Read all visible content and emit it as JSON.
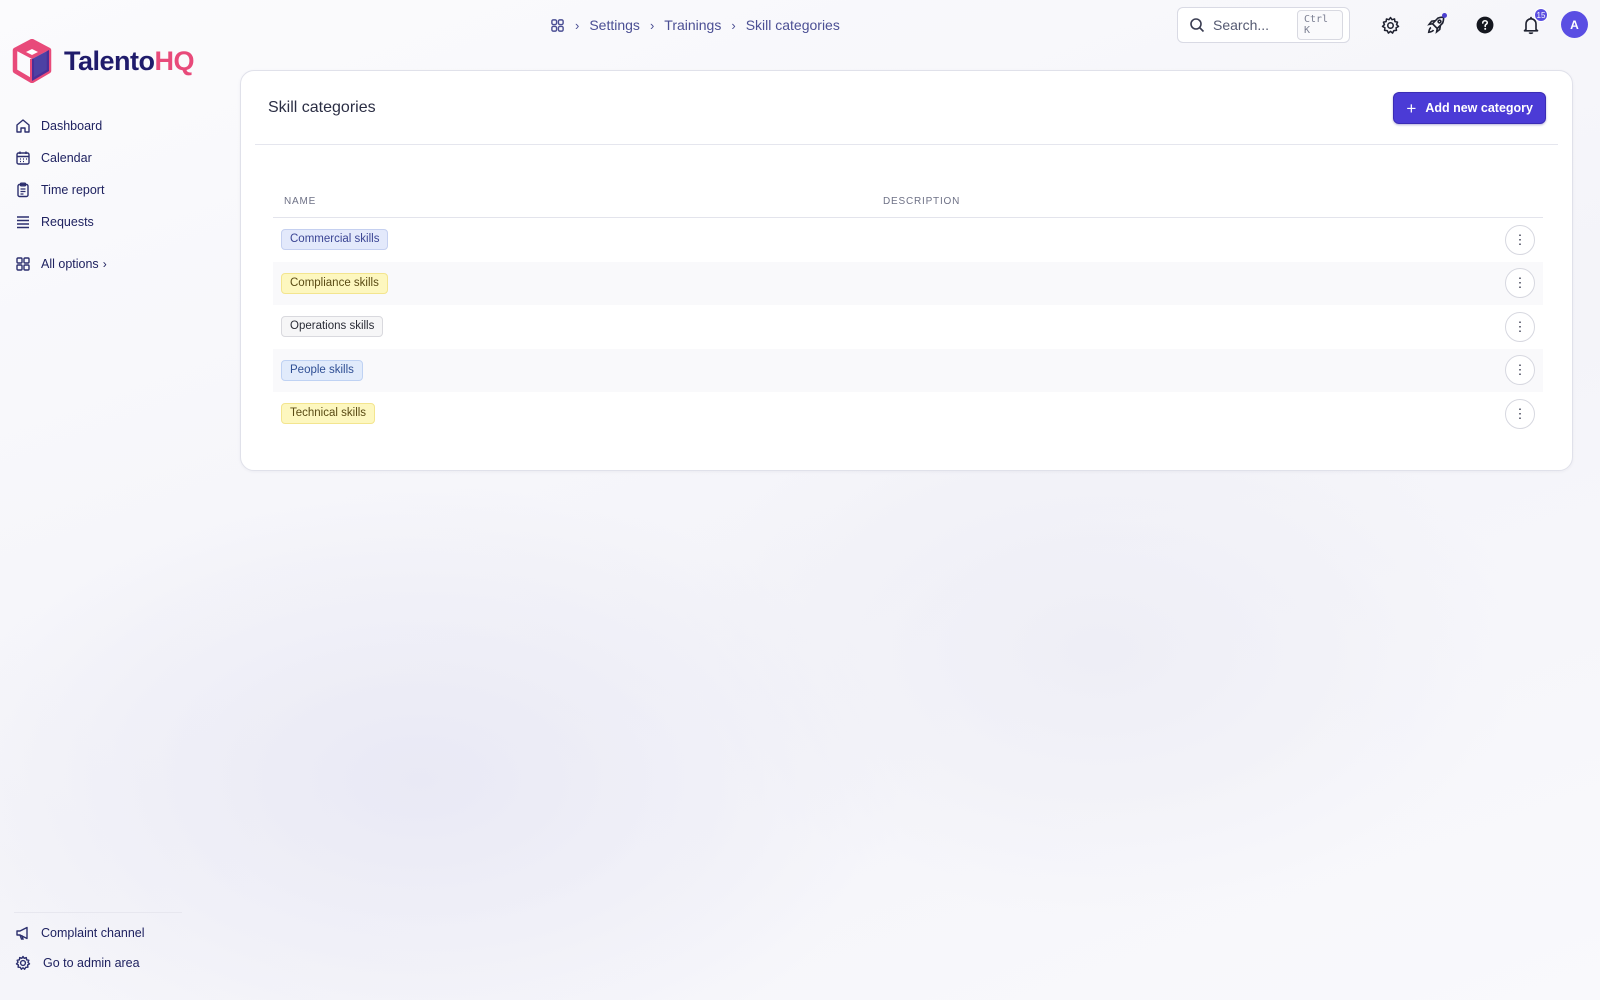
{
  "app": {
    "logo_part1": "Talento",
    "logo_part2": "HQ"
  },
  "sidebar": {
    "items": [
      {
        "label": "Dashboard",
        "icon": "home-icon"
      },
      {
        "label": "Calendar",
        "icon": "calendar-icon"
      },
      {
        "label": "Time report",
        "icon": "clipboard-icon"
      },
      {
        "label": "Requests",
        "icon": "list-icon"
      }
    ],
    "all_options": {
      "label": "All options",
      "icon": "grid-icon"
    },
    "bottom": [
      {
        "label": "Complaint channel",
        "icon": "megaphone-icon"
      },
      {
        "label": "Go to admin area",
        "icon": "gear-icon"
      }
    ]
  },
  "breadcrumb": {
    "home_icon": "grid-icon",
    "items": [
      "Settings",
      "Trainings",
      "Skill categories"
    ]
  },
  "search": {
    "placeholder": "Search...",
    "shortcut": "Ctrl K"
  },
  "topbar": {
    "notifications_count": "15",
    "avatar_initial": "A",
    "icons": [
      "gear-icon",
      "rocket-icon",
      "help-icon",
      "bell-icon"
    ]
  },
  "card": {
    "title": "Skill categories",
    "add_button_label": "Add new category"
  },
  "table": {
    "columns": [
      "NAME",
      "DESCRIPTION"
    ],
    "rows": [
      {
        "name": "Commercial skills",
        "description": "",
        "tag_color": "blue"
      },
      {
        "name": "Compliance skills",
        "description": "",
        "tag_color": "yellow"
      },
      {
        "name": "Operations skills",
        "description": "",
        "tag_color": "gray"
      },
      {
        "name": "People skills",
        "description": "",
        "tag_color": "lightblue"
      },
      {
        "name": "Technical skills",
        "description": "",
        "tag_color": "yellow"
      }
    ]
  },
  "colors": {
    "accent": "#4b3bd6",
    "brand_dark": "#1f1b6b",
    "brand_pink": "#e84a7a"
  }
}
